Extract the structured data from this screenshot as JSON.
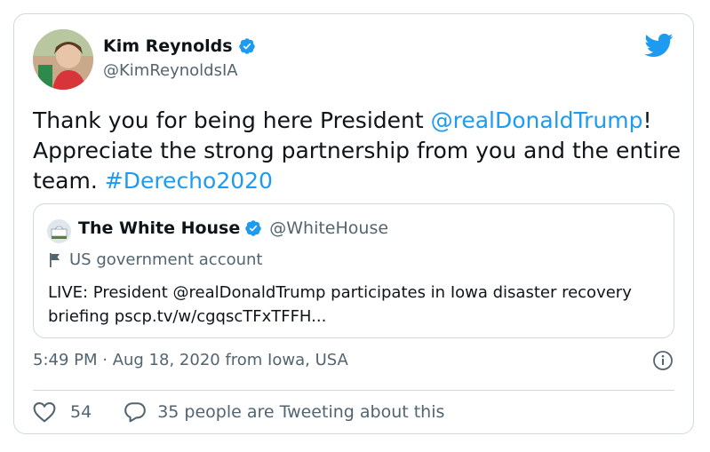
{
  "author": {
    "name": "Kim Reynolds",
    "handle": "@KimReynoldsIA"
  },
  "tweet": {
    "text_before": "Thank you for being here President ",
    "mention": "@realDonaldTrump",
    "text_after": "! Appreciate the strong partnership from you and the entire team. ",
    "hashtag": "#Derecho2020"
  },
  "quote": {
    "name": "The White House",
    "handle": "@WhiteHouse",
    "label": "US government account",
    "text": "LIVE: President @realDonaldTrump participates in Iowa disaster recovery briefing pscp.tv/w/cgqscTFxTFFH..."
  },
  "meta": {
    "timestamp": "5:49 PM · Aug 18, 2020 from Iowa, USA"
  },
  "actions": {
    "likes": "54",
    "talking": "35 people are Tweeting about this"
  },
  "colors": {
    "link": "#1d9bf0",
    "secondary_text": "#536471",
    "border": "#cfd9de",
    "verified": "#1d9bf0"
  },
  "icons": [
    "verified-icon",
    "twitter-bird-icon",
    "flag-icon",
    "info-icon",
    "heart-icon",
    "reply-bubble-icon"
  ]
}
